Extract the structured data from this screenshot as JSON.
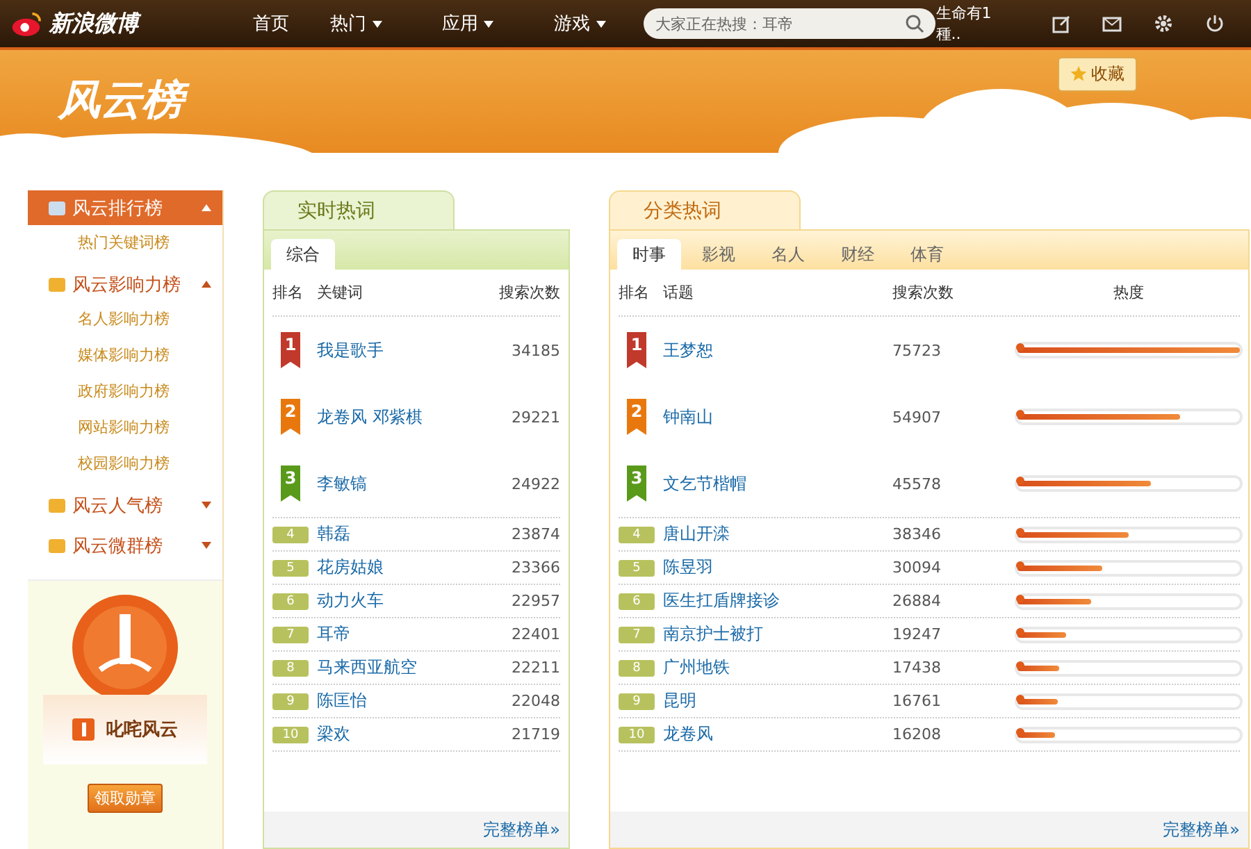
{
  "topbar": {
    "logo": "新浪微博",
    "nav": [
      {
        "label": "首页",
        "has_menu": false
      },
      {
        "label": "热门",
        "has_menu": true
      },
      {
        "label": "应用",
        "has_menu": true
      },
      {
        "label": "游戏",
        "has_menu": true
      }
    ],
    "search": {
      "placeholder": "大家正在热搜：耳帝"
    },
    "user": "生命有1種.."
  },
  "banner": {
    "logo": "风云榜",
    "favorite": "收藏"
  },
  "sidebar": {
    "groups": [
      {
        "label": "风云排行榜",
        "selected": true,
        "expanded": true,
        "children": [
          {
            "label": "热门关键词榜"
          }
        ]
      },
      {
        "label": "风云影响力榜",
        "selected": false,
        "expanded": true,
        "children": [
          {
            "label": "名人影响力榜"
          },
          {
            "label": "媒体影响力榜"
          },
          {
            "label": "政府影响力榜"
          },
          {
            "label": "网站影响力榜"
          },
          {
            "label": "校园影响力榜"
          }
        ]
      },
      {
        "label": "风云人气榜",
        "selected": false,
        "expanded": false
      },
      {
        "label": "风云微群榜",
        "selected": false,
        "expanded": false
      }
    ],
    "badge": {
      "title": "叱咤风云",
      "button": "领取勋章"
    }
  },
  "realtime": {
    "title": "实时热词",
    "tabs": [
      {
        "label": "综合",
        "selected": true
      }
    ],
    "columns": [
      "排名",
      "关键词",
      "搜索次数"
    ],
    "rows": [
      {
        "rank": "1",
        "keyword": "我是歌手",
        "count": "34185"
      },
      {
        "rank": "2",
        "keyword": "龙卷风 邓紫棋",
        "count": "29221"
      },
      {
        "rank": "3",
        "keyword": "李敏镐",
        "count": "24922"
      },
      {
        "rank": "4",
        "keyword": "韩磊",
        "count": "23874"
      },
      {
        "rank": "5",
        "keyword": "花房姑娘",
        "count": "23366"
      },
      {
        "rank": "6",
        "keyword": "动力火车",
        "count": "22957"
      },
      {
        "rank": "7",
        "keyword": "耳帝",
        "count": "22401"
      },
      {
        "rank": "8",
        "keyword": "马来西亚航空",
        "count": "22211"
      },
      {
        "rank": "9",
        "keyword": "陈匡怡",
        "count": "22048"
      },
      {
        "rank": "10",
        "keyword": "梁欢",
        "count": "21719"
      }
    ],
    "more": "完整榜单»"
  },
  "category": {
    "title": "分类热词",
    "tabs": [
      {
        "label": "时事",
        "selected": true
      },
      {
        "label": "影视",
        "selected": false
      },
      {
        "label": "名人",
        "selected": false
      },
      {
        "label": "财经",
        "selected": false
      },
      {
        "label": "体育",
        "selected": false
      }
    ],
    "columns": [
      "排名",
      "话题",
      "搜索次数",
      "热度"
    ],
    "rows": [
      {
        "rank": "1",
        "keyword": "王梦恕",
        "count": "75723",
        "level": 1.0
      },
      {
        "rank": "2",
        "keyword": "钟南山",
        "count": "54907",
        "level": 0.73
      },
      {
        "rank": "3",
        "keyword": "文乞节楷帽",
        "count": "45578",
        "level": 0.6
      },
      {
        "rank": "4",
        "keyword": "唐山开滦",
        "count": "38346",
        "level": 0.5
      },
      {
        "rank": "5",
        "keyword": "陈昱羽",
        "count": "30094",
        "level": 0.38
      },
      {
        "rank": "6",
        "keyword": "医生扛盾牌接诊",
        "count": "26884",
        "level": 0.33
      },
      {
        "rank": "7",
        "keyword": "南京护士被打",
        "count": "19247",
        "level": 0.22
      },
      {
        "rank": "8",
        "keyword": "广州地铁",
        "count": "17438",
        "level": 0.19
      },
      {
        "rank": "9",
        "keyword": "昆明",
        "count": "16761",
        "level": 0.18
      },
      {
        "rank": "10",
        "keyword": "龙卷风",
        "count": "16208",
        "level": 0.17
      }
    ],
    "more": "完整榜单»"
  }
}
